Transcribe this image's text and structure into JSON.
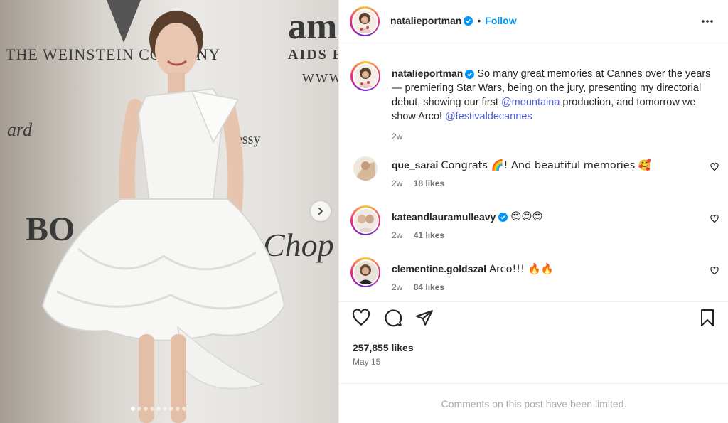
{
  "post": {
    "author": "natalieportman",
    "follow_label": "Follow",
    "header_separator": "•",
    "caption": {
      "part1": "So many great memories at Cannes over the years — premiering Star Wars, being on the jury, presenting my directorial debut, showing our first ",
      "mention1": "@mountaina",
      "part2": " production, and tomorrow we show Arco! ",
      "mention2": "@festivaldecannes",
      "age": "2w"
    },
    "likes": "257,855 likes",
    "date": "May 15",
    "comments_limited": "Comments on this post have been limited."
  },
  "backdrop": {
    "t1": "THE WEINSTEIN COMPANY",
    "t2": "am",
    "t3": "AIDS F",
    "t4": "WWW.",
    "t5": "ard",
    "t6": "essy",
    "t7": "BO",
    "t8": "Chop"
  },
  "comments": [
    {
      "user": "que_sarai",
      "text": "Congrats 🌈! And beautiful memories 🥰",
      "age": "2w",
      "likes": "18 likes",
      "ring": false
    },
    {
      "user": "kateandlauramulleavy",
      "text": "😍😍😍",
      "age": "2w",
      "likes": "41 likes",
      "ring": true,
      "verified": true
    },
    {
      "user": "clementine.goldszal",
      "text": "Arco!!! 🔥🔥",
      "age": "2w",
      "likes": "84 likes",
      "ring": true
    }
  ],
  "carousel": {
    "count": 9,
    "active": 1
  },
  "icons": {
    "more": "more-options-icon",
    "verified": "verified-badge-icon",
    "like": "heart-icon",
    "comment": "comment-icon",
    "share": "share-icon",
    "save": "bookmark-icon",
    "next": "chevron-right-icon"
  },
  "colors": {
    "accent": "#0095f6",
    "verified": "#0095f6",
    "mention": "#4f5fd4"
  }
}
